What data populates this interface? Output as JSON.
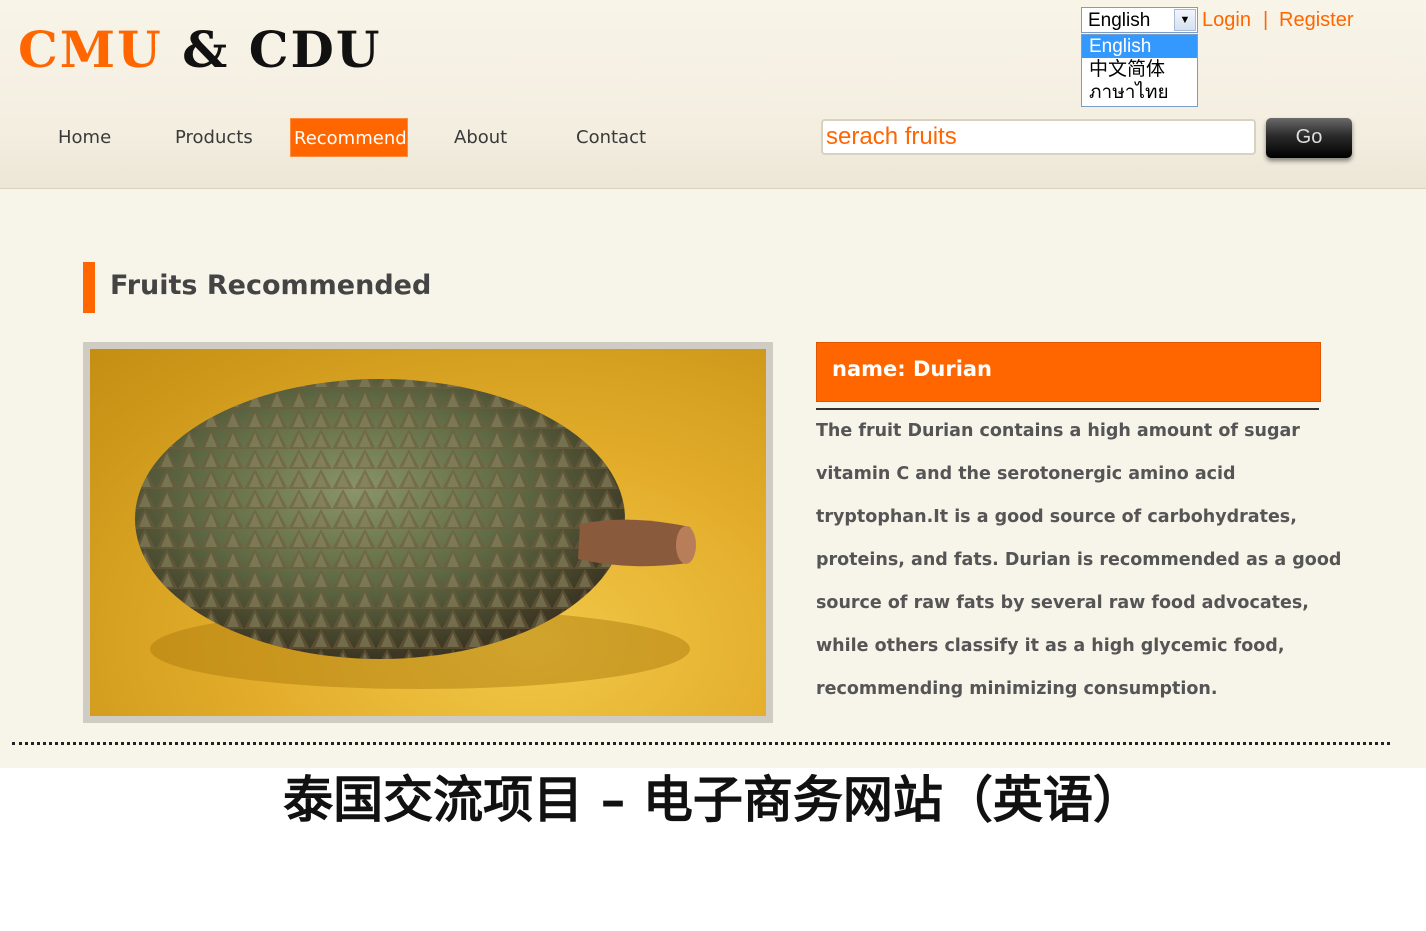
{
  "logo": {
    "part1": "CMU",
    "amp": "&",
    "part2": "CDU"
  },
  "language": {
    "selected": "English",
    "options": [
      "English",
      "中文简体",
      "ภาษาไทย"
    ]
  },
  "auth": {
    "login": "Login",
    "separator": "|",
    "register": "Register"
  },
  "nav": [
    {
      "label": "Home"
    },
    {
      "label": "Products"
    },
    {
      "label": "Recommend",
      "active": true
    },
    {
      "label": "About"
    },
    {
      "label": "Contact"
    }
  ],
  "search": {
    "placeholder": "serach fruits",
    "button": "Go"
  },
  "section": {
    "title": "Fruits Recommended"
  },
  "fruit": {
    "name_label": "name:  Durian",
    "description": [
      "The fruit Durian contains a high amount of sugar",
      "vitamin C and the serotonergic amino acid",
      "tryptophan.It is a good source of carbohydrates,",
      "proteins, and fats. Durian is recommended as a good",
      "source of raw fats by several raw food advocates,",
      "while others classify it as a high glycemic food,",
      "recommending minimizing consumption."
    ]
  },
  "caption": "泰国交流项目 – 电子商务网站（英语）",
  "colors": {
    "accent": "#ff6600",
    "background": "#f7f4ea"
  }
}
